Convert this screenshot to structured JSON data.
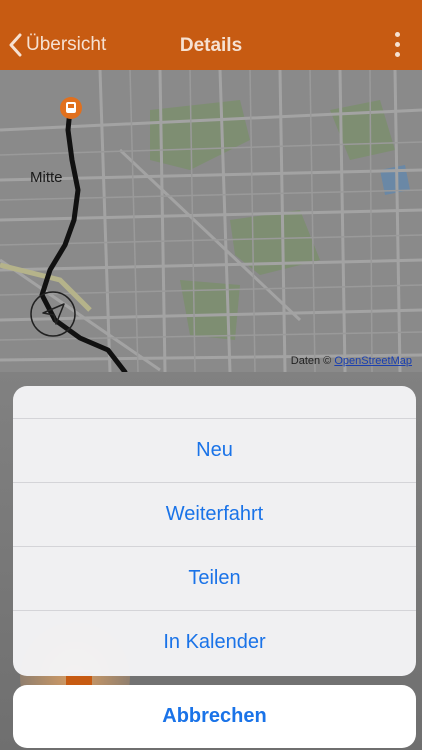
{
  "navbar": {
    "back_label": "Übersicht",
    "title": "Details",
    "menu_icon": "more-vertical-icon",
    "background_color": "#c75b12",
    "text_color": "#f6e1d2"
  },
  "map": {
    "district_label": "Mitte",
    "attribution_prefix": "Daten © ",
    "attribution_link": "OpenStreetMap",
    "start_marker_icon": "tram-icon",
    "locate_button_icon": "location-arrow-icon"
  },
  "action_sheet": {
    "options": [
      {
        "label": "Neu"
      },
      {
        "label": "Weiterfahrt"
      },
      {
        "label": "Teilen"
      },
      {
        "label": "In Kalender"
      }
    ],
    "cancel_label": "Abbrechen",
    "accent_color": "#1a73e8"
  }
}
